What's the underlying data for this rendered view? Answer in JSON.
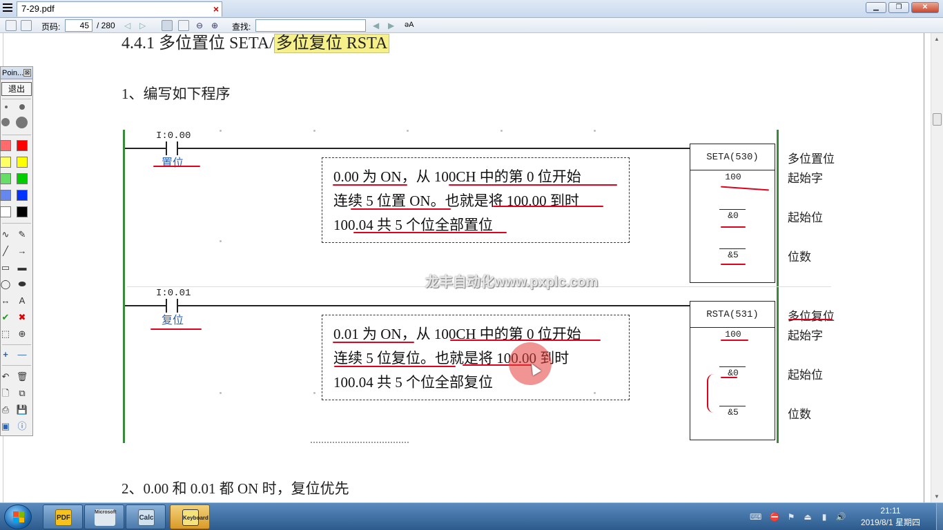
{
  "window": {
    "tab_title": "7-29.pdf",
    "tab_close": "×",
    "controls": {
      "minimize": "▁",
      "maximize": "❐",
      "close": "✕"
    }
  },
  "toolbar": {
    "page_label": "页码:",
    "page_current": "45",
    "page_total": "/ 280",
    "find_label": "查找:",
    "find_placeholder": "",
    "prev_arrow": "◀",
    "next_arrow": "▶",
    "font_icon": "ǝA"
  },
  "document": {
    "heading_prefix": "4.4.1 多位置位 SETA/",
    "heading_highlight": "多位复位 RSTA",
    "step1": "1、编写如下程序",
    "step2": "2、0.00 和 0.01 都 ON 时，复位优先",
    "watermark": "龙丰自动化www.pxplc.com",
    "rung1": {
      "address": "I:0.00",
      "contact_label": "置位",
      "note_line1": "0.00 为 ON，从 100CH 中的第 0 位开始",
      "note_line2": "连续 5 位置 ON。也就是将 100.00 到时",
      "note_line3": "100.04 共 5 个位全部置位",
      "func_name": "SETA(530)",
      "param1": "100",
      "param2": "&0",
      "param3": "&5",
      "side_label_0": "多位置位",
      "side_label_1": "起始字",
      "side_label_2": "起始位",
      "side_label_3": "位数"
    },
    "rung2": {
      "address": "I:0.01",
      "contact_label": "复位",
      "note_line1": "0.01 为 ON，从 100CH 中的第 0 位开始",
      "note_line2": "连续  5  位复位。也就是将  100.00  到时",
      "note_line3": "100.04 共 5 个位全部复位",
      "func_name": "RSTA(531)",
      "param1": "100",
      "param2": "&0",
      "param3": "&5",
      "side_label_0": "多位复位",
      "side_label_1": "起始字",
      "side_label_2": "起始位",
      "side_label_3": "位数"
    }
  },
  "palette": {
    "title": "Poin...",
    "close": "⊠",
    "exit_label": "退出",
    "colors": [
      "#ff6b6b",
      "#ff0000",
      "#ffff66",
      "#ffff00",
      "#66dd66",
      "#00cc00",
      "#6688ee",
      "#0033ff",
      "#ffffff",
      "#000000"
    ],
    "tools": {
      "curve": "∿",
      "pen": "✎",
      "line": "╱",
      "arrow": "→",
      "rect": "▭",
      "rect_fill": "▬",
      "ellipse": "◯",
      "ellipse_fill": "⬬",
      "double_arrow": "↔",
      "text": "A",
      "check": "✔",
      "cross": "✖",
      "select": "⬚",
      "zoom": "⊕",
      "plus": "+",
      "minus": "—",
      "undo": "↶",
      "trash": "🗑",
      "new": "🗋",
      "copy": "⧉",
      "print": "⎙",
      "save": "💾",
      "screen": "▣",
      "info": "ⓘ"
    }
  },
  "taskbar": {
    "apps": [
      "PDF",
      "Microsoft",
      "Calc",
      "Keyboard"
    ],
    "clock_time": "21:11",
    "clock_date": "2019/8/1 星期四",
    "tray": {
      "keyboard": "⌨",
      "stop": "⛔",
      "network": "▮",
      "volume": "🔊",
      "usb": "⏏",
      "flag": "⚑"
    }
  }
}
